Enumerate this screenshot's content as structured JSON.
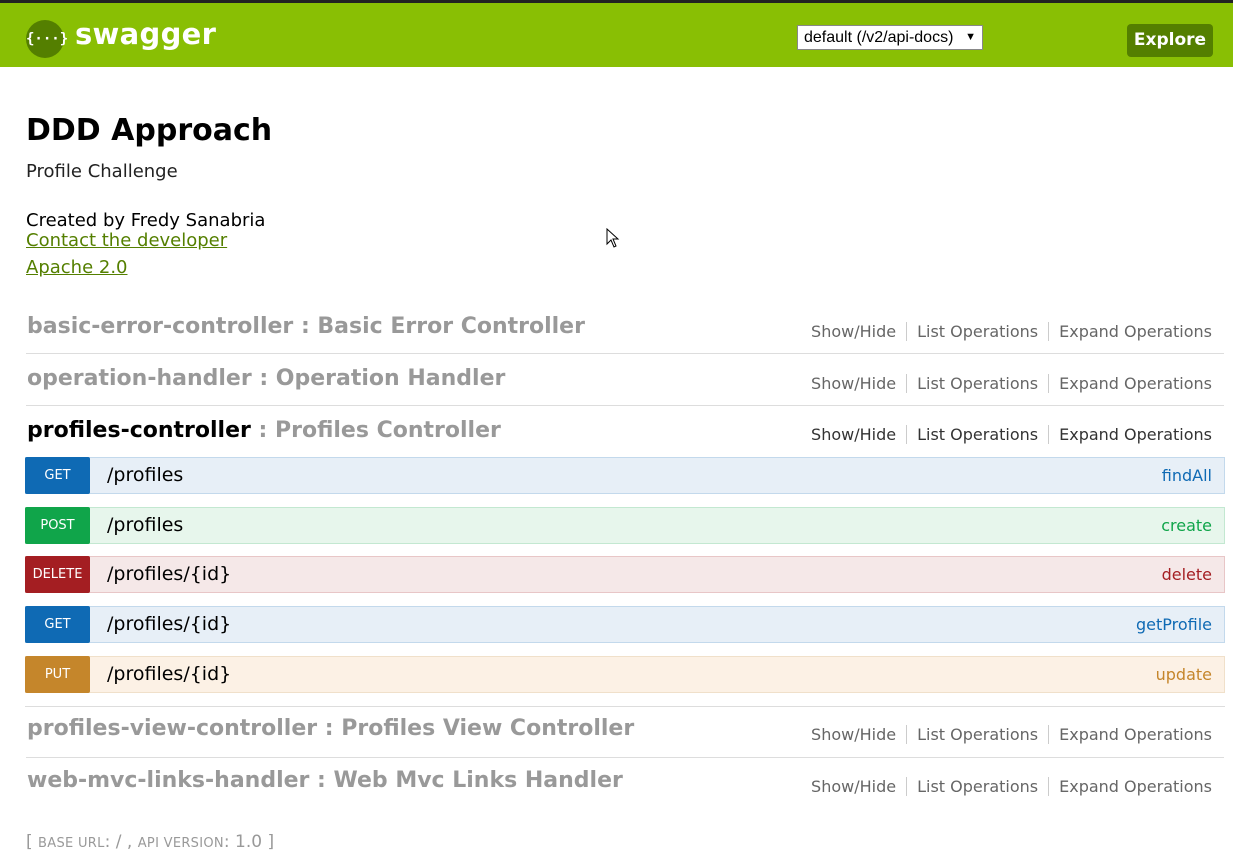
{
  "header": {
    "logo_glyph": "{···}",
    "brand": "swagger",
    "spec_selector": "default (/v2/api-docs)",
    "explore_label": "Explore",
    "color": "#89bf04",
    "dark_color": "#547f00"
  },
  "info": {
    "title": "DDD Approach",
    "description": "Profile Challenge",
    "created_by": "Created by Fredy Sanabria",
    "contact_link": "Contact the developer",
    "license_link": "Apache 2.0"
  },
  "resource_actions": {
    "show_hide": "Show/Hide",
    "list_operations": "List Operations",
    "expand_operations": "Expand Operations"
  },
  "resources": [
    {
      "name": "basic-error-controller",
      "description": " : Basic Error Controller"
    },
    {
      "name": "operation-handler",
      "description": " : Operation Handler"
    },
    {
      "name": "profiles-controller",
      "description": " : Profiles Controller"
    },
    {
      "name": "profiles-view-controller",
      "description": " : Profiles View Controller"
    },
    {
      "name": "web-mvc-links-handler",
      "description": " : Web Mvc Links Handler"
    }
  ],
  "operations": [
    {
      "method": "GET",
      "path": "/profiles",
      "nickname": "findAll"
    },
    {
      "method": "POST",
      "path": "/profiles",
      "nickname": "create"
    },
    {
      "method": "DELETE",
      "path": "/profiles/{id}",
      "nickname": "delete"
    },
    {
      "method": "GET",
      "path": "/profiles/{id}",
      "nickname": "getProfile"
    },
    {
      "method": "PUT",
      "path": "/profiles/{id}",
      "nickname": "update"
    }
  ],
  "footer": {
    "open": "[ ",
    "base_url_label": "BASE URL",
    "base_url_value": ": / , ",
    "api_version_label": "API VERSION",
    "api_version_value": ": 1.0 ]"
  }
}
